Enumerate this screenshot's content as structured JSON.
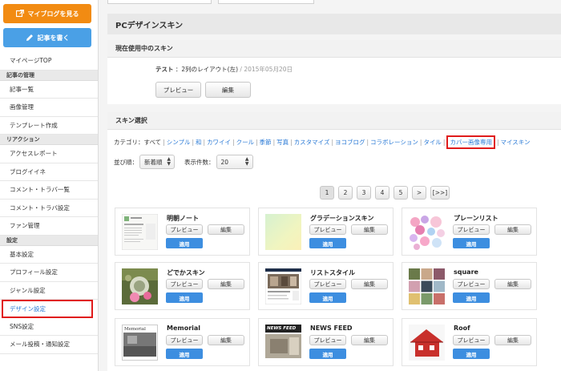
{
  "sidebar": {
    "myblog_label": "マイブログを見る",
    "write_label": "記事を書く",
    "mypage": "マイページTOP",
    "sections": [
      {
        "head": "記事の管理",
        "items": [
          "記事一覧",
          "画像管理",
          "テンプレート作成"
        ]
      },
      {
        "head": "リアクション",
        "items": [
          "アクセスレポート",
          "ブログイイネ",
          "コメント・トラバ一覧",
          "コメント・トラバ設定",
          "ファン管理"
        ]
      },
      {
        "head": "設定",
        "items": [
          "基本設定",
          "プロフィール設定",
          "ジャンル設定",
          "デザイン設定",
          "SNS設定",
          "メール投稿・通知設定"
        ]
      }
    ],
    "active_item": "デザイン設定"
  },
  "main": {
    "page_title": "PCデザインスキン",
    "current_skin": {
      "section_title": "現在使用中のスキン",
      "name": "テスト",
      "layout": "：2列のレイアウト(左)",
      "divider": "/",
      "date": "2015年05月20日",
      "preview_label": "プレビュー",
      "edit_label": "編集"
    },
    "skin_select": {
      "section_title": "スキン選択",
      "category_label": "カテゴリ：",
      "categories": [
        "すべて",
        "シンプル",
        "和",
        "カワイイ",
        "クール",
        "季節",
        "写真",
        "カスタマイズ",
        "ヨコブログ",
        "コラボレーション",
        "タイル",
        "カバー画像専用",
        "マイスキン"
      ],
      "highlighted_category": "カバー画像専用",
      "sort_label": "並び順：",
      "sort_value": "新着順",
      "count_label": "表示件数：",
      "count_value": "20",
      "pages": [
        "1",
        "2",
        "3",
        "4",
        "5",
        ">",
        "[>>]"
      ],
      "current_page": "1"
    },
    "card_labels": {
      "preview": "プレビュー",
      "edit": "編集",
      "apply": "適用"
    },
    "skins": [
      {
        "name": "明朝ノート"
      },
      {
        "name": "グラデーションスキン"
      },
      {
        "name": "プレーンリスト"
      },
      {
        "name": "どでかスキン"
      },
      {
        "name": "リストスタイル"
      },
      {
        "name": "square"
      },
      {
        "name": "Memorial"
      },
      {
        "name": "NEWS FEED"
      },
      {
        "name": "Roof"
      }
    ],
    "thumb_texts": {
      "memorial": "Memorial",
      "newsfeed": "NEWS FEED"
    }
  }
}
